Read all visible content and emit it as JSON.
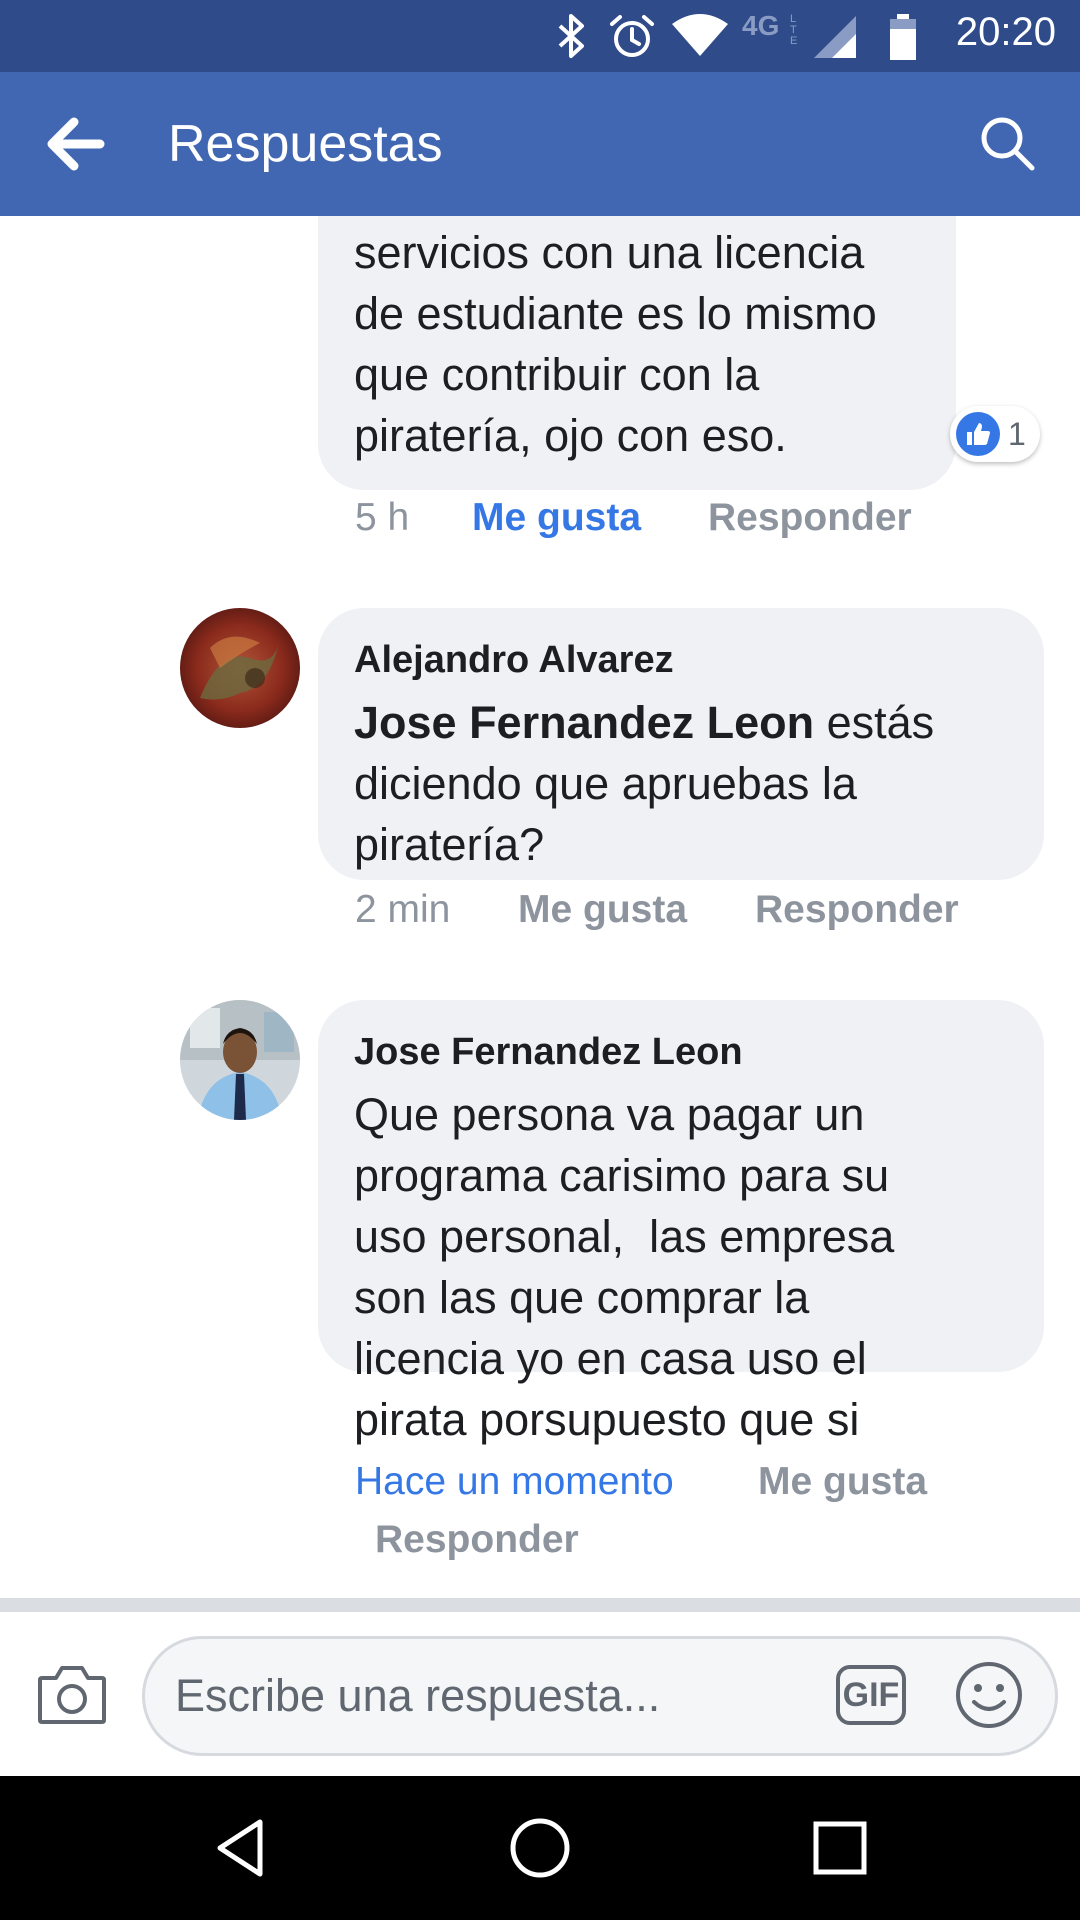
{
  "status_bar": {
    "time": "20:20",
    "network": "4G",
    "network_sub": "LTE",
    "icons": [
      "bluetooth-icon",
      "alarm-icon",
      "wifi-icon",
      "signal-icon",
      "battery-icon"
    ]
  },
  "header": {
    "title": "Respuestas",
    "back_icon": "arrow-left-icon",
    "search_icon": "search-icon"
  },
  "comments": [
    {
      "author": "",
      "text_lines": [
        "servicios con una licencia",
        "de estudiante es lo mismo",
        "que contribuir con la",
        "piratería, ojo con eso."
      ],
      "reaction_count": "1",
      "time": "5 h",
      "like_label": "Me gusta",
      "like_active": true,
      "reply_label": "Responder"
    },
    {
      "author": "Alejandro Alvarez",
      "mention": "Jose Fernandez Leon",
      "text": " estás\ndiciendo que apruebas la\npiratería?",
      "time": "2 min",
      "like_label": "Me gusta",
      "reply_label": "Responder"
    },
    {
      "author": "Jose Fernandez Leon",
      "text": "Que persona va pagar un\nprograma carisimo para su\nuso personal,  las empresa\nson las que comprar la\nlicencia yo en casa uso el\npirata porsupuesto que si",
      "time": "Hace un momento",
      "like_label": "Me gusta",
      "reply_label": "Responder"
    }
  ],
  "composer": {
    "placeholder": "Escribe una respuesta...",
    "gif_label": "GIF",
    "camera_icon": "camera-icon",
    "emoji_icon": "emoji-icon"
  },
  "nav_bar": {
    "icons": [
      "back-triangle-icon",
      "home-circle-icon",
      "recents-square-icon"
    ]
  },
  "colors": {
    "status_bar": "#2f4b8a",
    "app_bar": "#4267b2",
    "bubble": "#f0f1f4",
    "link_blue": "#3578e5",
    "meta_gray": "#8d949e"
  }
}
